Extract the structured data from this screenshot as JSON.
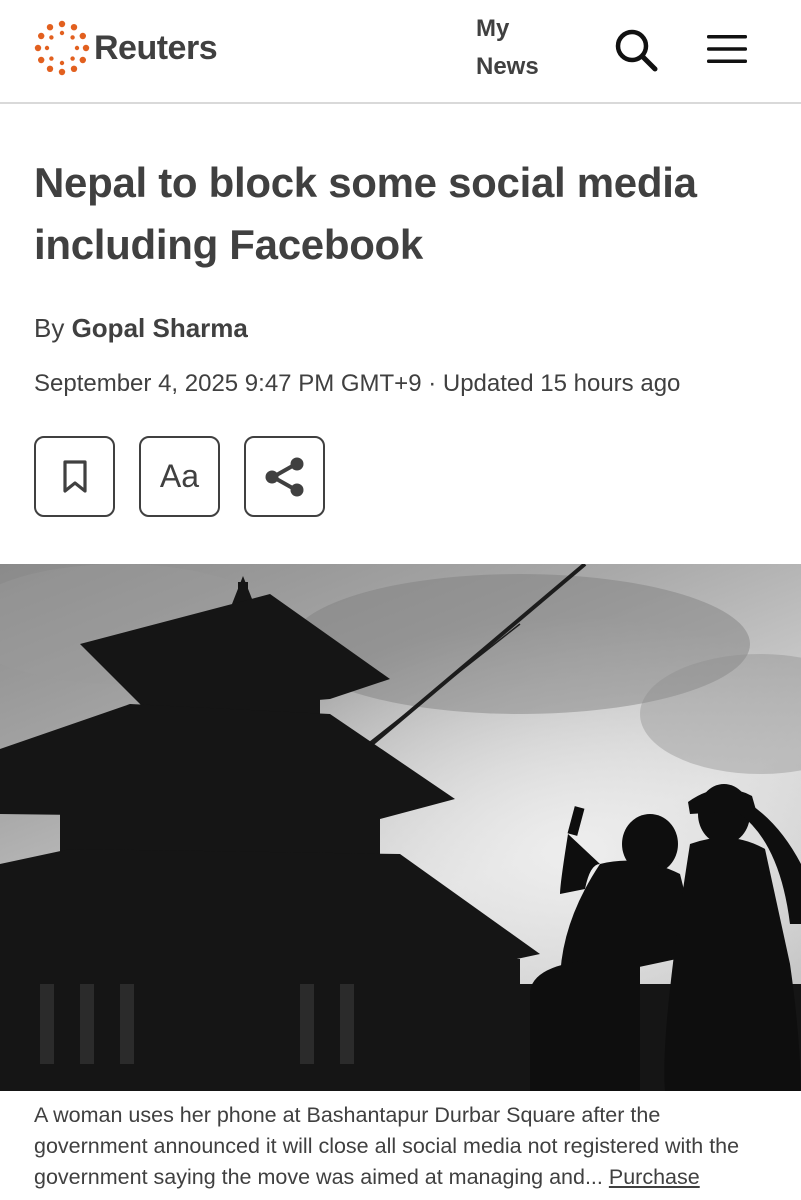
{
  "header": {
    "logo_text": "Reuters",
    "logo_icon": "reuters-dot-ring-logo",
    "my_news_line1": "My",
    "my_news_line2": "News",
    "search_icon": "search-icon",
    "menu_icon": "hamburger-menu-icon",
    "brand_color": "#e2601f"
  },
  "article": {
    "headline": "Nepal to block some social media including Facebook",
    "byline_prefix": "By ",
    "author": "Gopal Sharma",
    "dateline": "September 4, 2025 9:47 PM GMT+9 · Updated 15 hours ago",
    "tools": {
      "bookmark_icon": "bookmark-icon",
      "text_size_label": "Aa",
      "share_icon": "share-icon"
    },
    "photo": {
      "subject": "silhouettes of two women and a pagoda temple against cloudy sky"
    },
    "caption_text": "A woman uses her phone at Bashantapur Durbar Square after the government announced it will close all social media not registered with the government saying the move was aimed at managing and...",
    "caption_link": "Purchase"
  }
}
